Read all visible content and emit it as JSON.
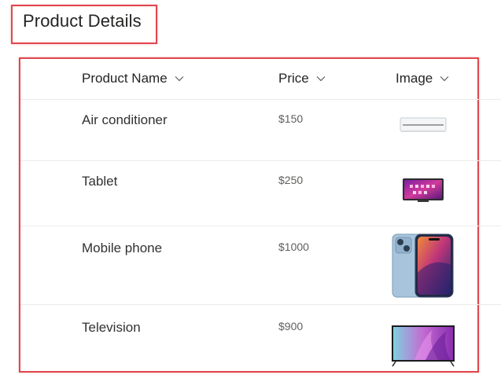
{
  "section": {
    "title": "Product Details"
  },
  "columns": [
    {
      "label": "Product Name"
    },
    {
      "label": "Price"
    },
    {
      "label": "Image"
    }
  ],
  "rows": [
    {
      "name": "Air conditioner",
      "price": "$150",
      "image_icon": "air-conditioner-image"
    },
    {
      "name": "Tablet",
      "price": "$250",
      "image_icon": "tablet-image"
    },
    {
      "name": "Mobile phone",
      "price": "$1000",
      "image_icon": "mobile-phone-image"
    },
    {
      "name": "Television",
      "price": "$900",
      "image_icon": "television-image"
    }
  ],
  "colors": {
    "highlight_border": "#e0484d",
    "divider": "#edebe9",
    "text_primary": "#323130",
    "text_secondary": "#605e5c"
  }
}
